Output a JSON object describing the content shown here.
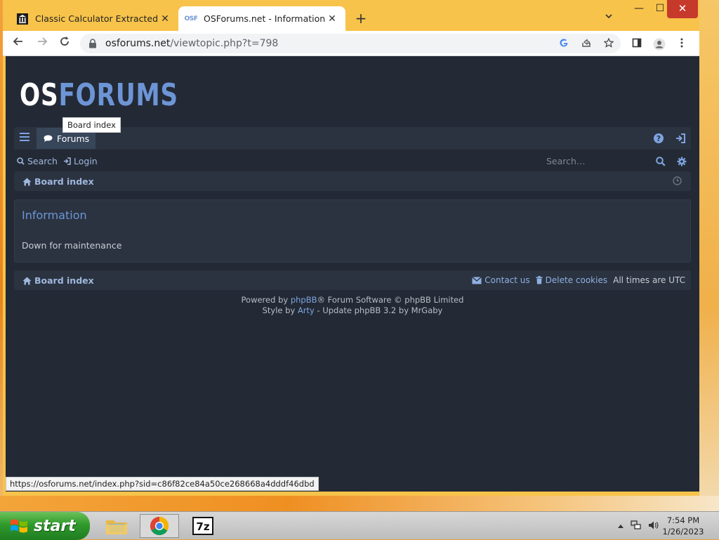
{
  "browser": {
    "tabs": [
      {
        "title": "Classic Calculator Extracted From",
        "favicon": "museum-icon",
        "active": false
      },
      {
        "title": "OSForums.net - Information",
        "favicon": "osf-icon",
        "favicon_text": "OSF",
        "active": true
      }
    ],
    "new_tab_label": "+",
    "address": {
      "host": "osforums.net",
      "path": "/viewtopic.php?t=798"
    },
    "window_controls": {
      "minimize": "—",
      "maximize": "☐",
      "close": "✕"
    }
  },
  "site": {
    "logo": {
      "part1": "OS",
      "part2": "FORUMS"
    },
    "nav": {
      "forums_label": "Forums"
    },
    "tooltip": "Board index",
    "quick_links": {
      "search_label": "Search",
      "login_label": "Login"
    },
    "search": {
      "placeholder": "Search…"
    },
    "breadcrumb": {
      "home_label": "Board index"
    },
    "panel": {
      "title": "Information",
      "message": "Down for maintenance"
    },
    "footer": {
      "home_label": "Board index",
      "contact_label": "Contact us",
      "cookies_label": "Delete cookies",
      "timezone_label": "All times are UTC"
    },
    "credits": {
      "line1_pre": "Powered by ",
      "line1_link": "phpBB",
      "line1_post": "® Forum Software © phpBB Limited",
      "line2_pre": "Style by ",
      "line2_link": "Arty",
      "line2_post": " - Update phpBB 3.2 by MrGaby"
    },
    "colors": {
      "background": "#232a35",
      "panel": "#2b3340",
      "accent": "#6d95d6",
      "link": "#9fb7dd"
    }
  },
  "status_bar": {
    "hover_url": "https://osforums.net/index.php?sid=c86f82ce84a50ce268668a4dddf46dbd"
  },
  "taskbar": {
    "start_label": "start",
    "apps": [
      "file-manager-icon",
      "chrome-icon",
      "7zip-icon"
    ],
    "clock": {
      "time": "7:54 PM",
      "date": "1/26/2023"
    }
  }
}
